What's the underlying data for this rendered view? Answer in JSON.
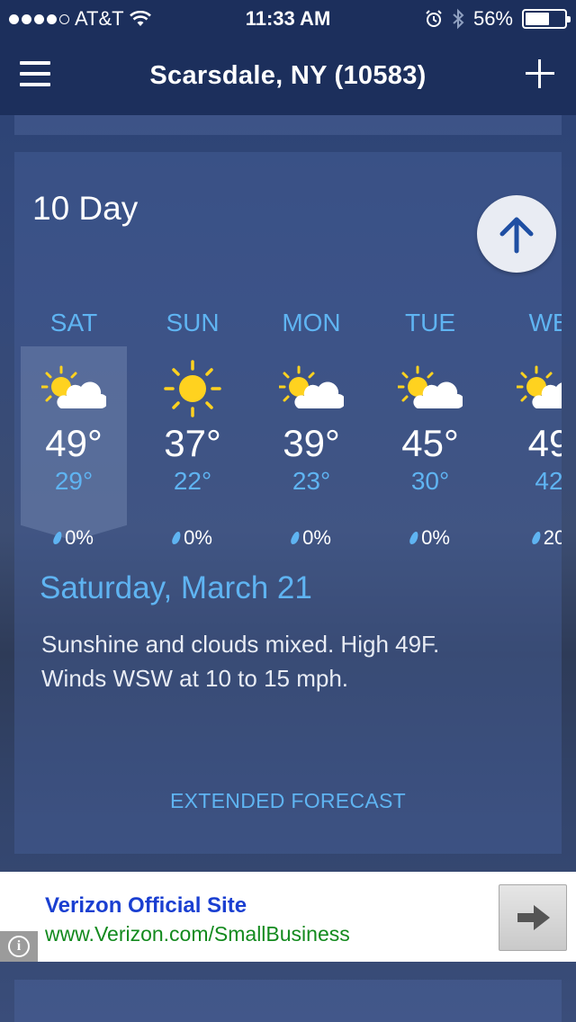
{
  "status_bar": {
    "carrier": "AT&T",
    "signal_bars_filled": 4,
    "signal_bars_total": 5,
    "time": "11:33 AM",
    "battery_percent": "56%",
    "battery_level": 0.56
  },
  "nav": {
    "title": "Scarsdale, NY (10583)"
  },
  "forecast_card": {
    "title": "10 Day",
    "days": [
      {
        "name": "SAT",
        "icon": "partly-sunny-icon",
        "high": "49°",
        "low": "29°",
        "precip": "0%"
      },
      {
        "name": "SUN",
        "icon": "sunny-icon",
        "high": "37°",
        "low": "22°",
        "precip": "0%"
      },
      {
        "name": "MON",
        "icon": "partly-sunny-icon",
        "high": "39°",
        "low": "23°",
        "precip": "0%"
      },
      {
        "name": "TUE",
        "icon": "partly-sunny-icon",
        "high": "45°",
        "low": "30°",
        "precip": "0%"
      },
      {
        "name": "WE",
        "icon": "partly-sunny-icon",
        "high": "49",
        "low": "42",
        "precip": "20"
      }
    ],
    "selected_date": "Saturday, March 21",
    "description_line1": "Sunshine and clouds mixed. High 49F.",
    "description_line2": "Winds WSW at 10 to 15 mph.",
    "extended_label": "EXTENDED FORECAST"
  },
  "ad": {
    "title": "Verizon Official Site",
    "url": "www.Verizon.com/SmallBusiness"
  },
  "colors": {
    "accent": "#5fb4f2",
    "navbar": "#1c2f5c",
    "ad_title": "#1a3fd1",
    "ad_url": "#138a1e"
  }
}
